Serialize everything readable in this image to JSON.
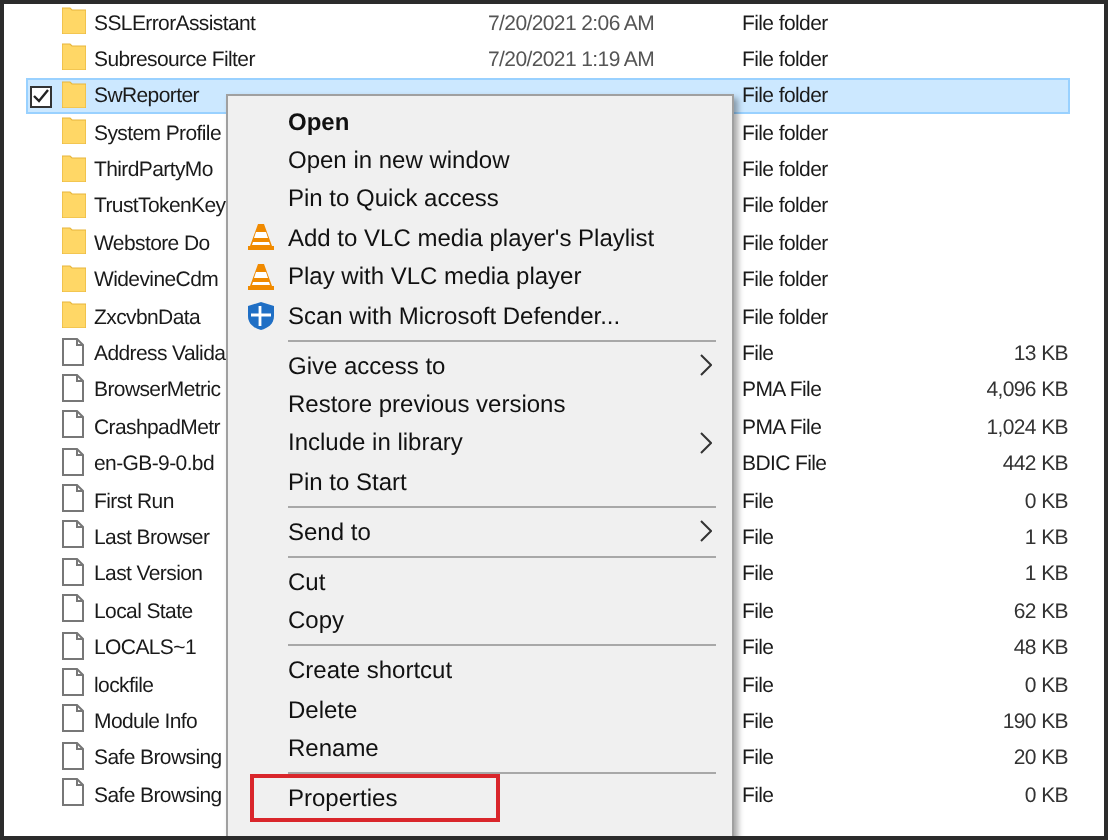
{
  "files": [
    {
      "kind": "folder",
      "name": "SSLErrorAssistant",
      "date": "7/20/2021 2:06 AM",
      "type": "File folder",
      "selected": false,
      "checked": false
    },
    {
      "kind": "folder",
      "name": "Subresource Filter",
      "date": "7/20/2021 1:19 AM",
      "type": "File folder",
      "selected": false,
      "checked": false
    },
    {
      "kind": "folder",
      "name": "SwReporter",
      "type": "File folder",
      "selected": true,
      "checked": true
    },
    {
      "kind": "folder",
      "name": "System Profile",
      "type": "File folder",
      "selected": false,
      "checked": false
    },
    {
      "kind": "folder",
      "name": "ThirdPartyMo",
      "type": "File folder",
      "selected": false,
      "checked": false
    },
    {
      "kind": "folder",
      "name": "TrustTokenKey",
      "type": "File folder",
      "selected": false,
      "checked": false
    },
    {
      "kind": "folder",
      "name": "Webstore Do",
      "type": "File folder",
      "selected": false,
      "checked": false
    },
    {
      "kind": "folder",
      "name": "WidevineCdm",
      "type": "File folder",
      "selected": false,
      "checked": false
    },
    {
      "kind": "folder",
      "name": "ZxcvbnData",
      "type": "File folder",
      "selected": false,
      "checked": false
    },
    {
      "kind": "file",
      "name": "Address Valida",
      "type": "File",
      "size": "13 KB",
      "selected": false,
      "checked": false
    },
    {
      "kind": "file",
      "name": "BrowserMetric",
      "type": "PMA File",
      "size": "4,096 KB",
      "selected": false,
      "checked": false
    },
    {
      "kind": "file",
      "name": "CrashpadMetr",
      "type": "PMA File",
      "size": "1,024 KB",
      "selected": false,
      "checked": false
    },
    {
      "kind": "file",
      "name": "en-GB-9-0.bd",
      "type": "BDIC File",
      "size": "442 KB",
      "selected": false,
      "checked": false
    },
    {
      "kind": "file",
      "name": "First Run",
      "type": "File",
      "size": "0 KB",
      "selected": false,
      "checked": false
    },
    {
      "kind": "file",
      "name": "Last Browser",
      "type": "File",
      "size": "1 KB",
      "selected": false,
      "checked": false
    },
    {
      "kind": "file",
      "name": "Last Version",
      "type": "File",
      "size": "1 KB",
      "selected": false,
      "checked": false
    },
    {
      "kind": "file",
      "name": "Local State",
      "type": "File",
      "size": "62 KB",
      "selected": false,
      "checked": false
    },
    {
      "kind": "file",
      "name": "LOCALS~1",
      "type": "File",
      "size": "48 KB",
      "selected": false,
      "checked": false
    },
    {
      "kind": "file",
      "name": "lockfile",
      "type": "File",
      "size": "0 KB",
      "selected": false,
      "checked": false
    },
    {
      "kind": "file",
      "name": "Module Info",
      "type": "File",
      "size": "190 KB",
      "selected": false,
      "checked": false
    },
    {
      "kind": "file",
      "name": "Safe Browsing",
      "type": "File",
      "size": "20 KB",
      "selected": false,
      "checked": false
    },
    {
      "kind": "file",
      "name": "Safe Browsing",
      "type": "File",
      "size": "0 KB",
      "selected": false,
      "checked": false
    }
  ],
  "context_menu": [
    {
      "kind": "item",
      "label": "Open",
      "default": true
    },
    {
      "kind": "item",
      "label": "Open in new window"
    },
    {
      "kind": "item",
      "label": "Pin to Quick access"
    },
    {
      "kind": "cone_item",
      "label": "Add to VLC media player's Playlist"
    },
    {
      "kind": "cone_item",
      "label": "Play with VLC media player"
    },
    {
      "kind": "shield_item",
      "label": "Scan with Microsoft Defender..."
    },
    {
      "kind": "separator"
    },
    {
      "kind": "item",
      "label": "Give access to",
      "submenu": true
    },
    {
      "kind": "item",
      "label": "Restore previous versions"
    },
    {
      "kind": "item",
      "label": "Include in library",
      "submenu": true
    },
    {
      "kind": "item",
      "label": "Pin to Start"
    },
    {
      "kind": "separator"
    },
    {
      "kind": "item",
      "label": "Send to",
      "submenu": true
    },
    {
      "kind": "separator"
    },
    {
      "kind": "item",
      "label": "Cut"
    },
    {
      "kind": "item",
      "label": "Copy"
    },
    {
      "kind": "separator"
    },
    {
      "kind": "item",
      "label": "Create shortcut"
    },
    {
      "kind": "item",
      "label": "Delete"
    },
    {
      "kind": "item",
      "label": "Rename"
    },
    {
      "kind": "separator"
    },
    {
      "kind": "item",
      "label": "Properties",
      "highlighted": true
    }
  ]
}
